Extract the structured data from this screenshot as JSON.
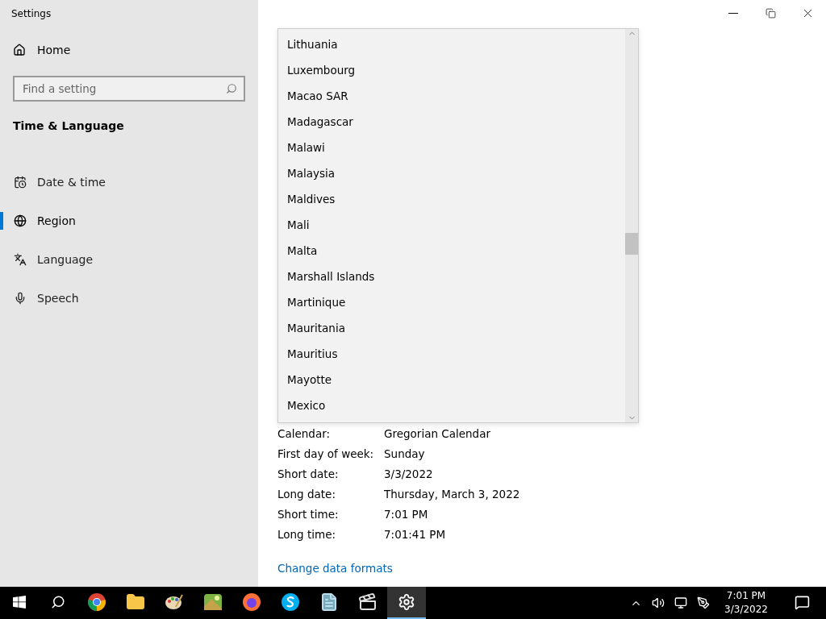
{
  "window": {
    "title": "Settings"
  },
  "sidebar": {
    "home": "Home",
    "search": {
      "placeholder": "Find a setting"
    },
    "section": "Time & Language",
    "items": [
      {
        "label": "Date & time",
        "kind": "calendar",
        "selected": false
      },
      {
        "label": "Region",
        "kind": "globe",
        "selected": true
      },
      {
        "label": "Language",
        "kind": "language",
        "selected": false
      },
      {
        "label": "Speech",
        "kind": "mic",
        "selected": false
      }
    ]
  },
  "country_list": [
    "Lithuania",
    "Luxembourg",
    "Macao SAR",
    "Madagascar",
    "Malawi",
    "Malaysia",
    "Maldives",
    "Mali",
    "Malta",
    "Marshall Islands",
    "Martinique",
    "Mauritania",
    "Mauritius",
    "Mayotte",
    "Mexico"
  ],
  "formats": [
    {
      "label": "Calendar:",
      "value": "Gregorian Calendar"
    },
    {
      "label": "First day of week:",
      "value": "Sunday"
    },
    {
      "label": "Short date:",
      "value": "3/3/2022"
    },
    {
      "label": "Long date:",
      "value": "Thursday, March 3, 2022"
    },
    {
      "label": "Short time:",
      "value": "7:01 PM"
    },
    {
      "label": "Long time:",
      "value": "7:01:41 PM"
    }
  ],
  "change_link": "Change data formats",
  "taskbar": {
    "apps": [
      {
        "kind": "chrome",
        "selected": false
      },
      {
        "kind": "folder",
        "selected": false
      },
      {
        "kind": "paint",
        "selected": false
      },
      {
        "kind": "photo",
        "selected": false
      },
      {
        "kind": "firefox",
        "selected": false
      },
      {
        "kind": "skype",
        "selected": false
      },
      {
        "kind": "notepad",
        "selected": false
      },
      {
        "kind": "clapper",
        "selected": false
      },
      {
        "kind": "settings",
        "selected": true
      }
    ],
    "time": "7:01 PM",
    "date": "3/3/2022"
  }
}
